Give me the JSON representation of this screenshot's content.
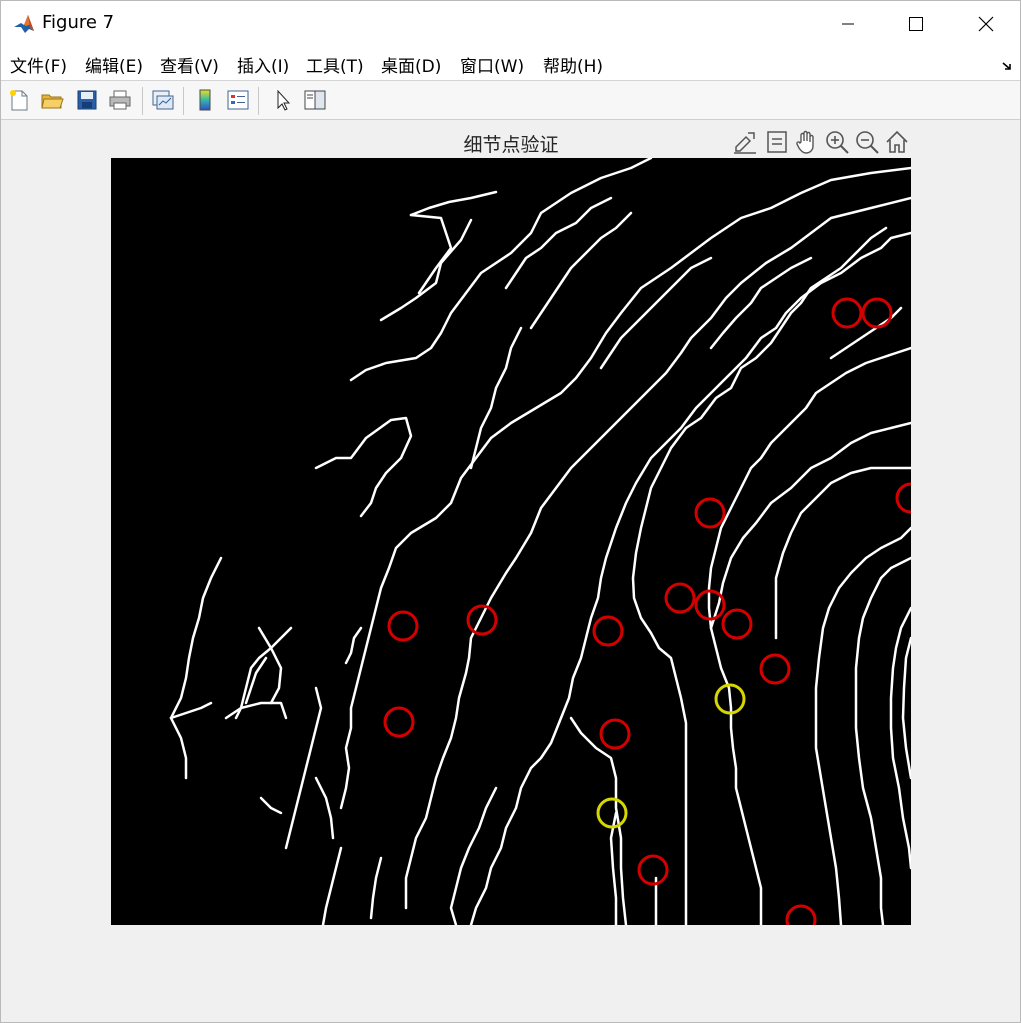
{
  "window": {
    "title": "Figure 7",
    "controls": [
      "minimize",
      "maximize",
      "close"
    ]
  },
  "menu": {
    "items": [
      "文件(F)",
      "编辑(E)",
      "查看(V)",
      "插入(I)",
      "工具(T)",
      "桌面(D)",
      "窗口(W)",
      "帮助(H)"
    ]
  },
  "toolbar": {
    "buttons": [
      "new-figure-icon",
      "open-file-icon",
      "save-icon",
      "print-icon",
      "link-plot-icon",
      "colorbar-icon",
      "legend-icon",
      "select-arrow-icon",
      "property-inspector-icon"
    ]
  },
  "axes_toolbar": {
    "buttons": [
      "export-icon",
      "data-tips-icon",
      "pan-hand-icon",
      "zoom-in-icon",
      "zoom-out-icon",
      "home-icon"
    ]
  },
  "figure": {
    "title": "细节点验证",
    "background_color": "#000000",
    "ridge_color": "#ffffff",
    "marker_colors": {
      "red": "#d40000",
      "yellow": "#d6d600"
    }
  }
}
